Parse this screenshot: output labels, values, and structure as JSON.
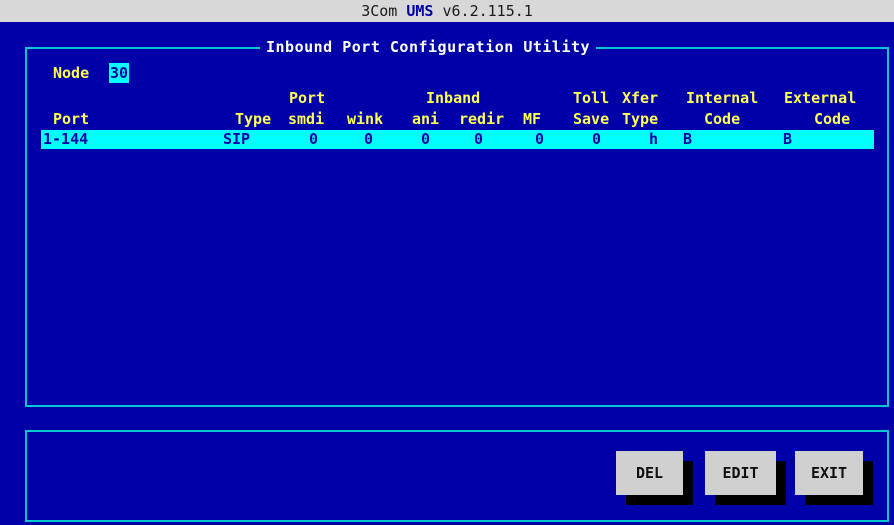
{
  "title": {
    "prefix": "3Com ",
    "brand": "UMS",
    "version": " v6.2.115.1"
  },
  "frame_title": "Inbound Port Configuration Utility",
  "node": {
    "label": "Node",
    "value": "30"
  },
  "headers": {
    "port_group": "Port",
    "inband_group": "Inband",
    "toll": "Toll",
    "xfer": "Xfer",
    "internal": "Internal",
    "external": "External",
    "port": "Port",
    "type": "Type",
    "smdi": "smdi",
    "wink": "wink",
    "ani": "ani",
    "redir": "redir",
    "mf": "MF",
    "save": "Save",
    "xfer_type": "Type",
    "internal_code": "Code",
    "external_code": "Code"
  },
  "rows": [
    {
      "port": "1-144",
      "type": "SIP",
      "smdi": "0",
      "wink": "0",
      "ani": "0",
      "redir": "0",
      "mf": "0",
      "toll_save": "0",
      "xfer_type": "h",
      "internal_code": "B",
      "external_code": "B"
    }
  ],
  "buttons": {
    "del": "DEL",
    "edit": "EDIT",
    "exit": "EXIT"
  }
}
